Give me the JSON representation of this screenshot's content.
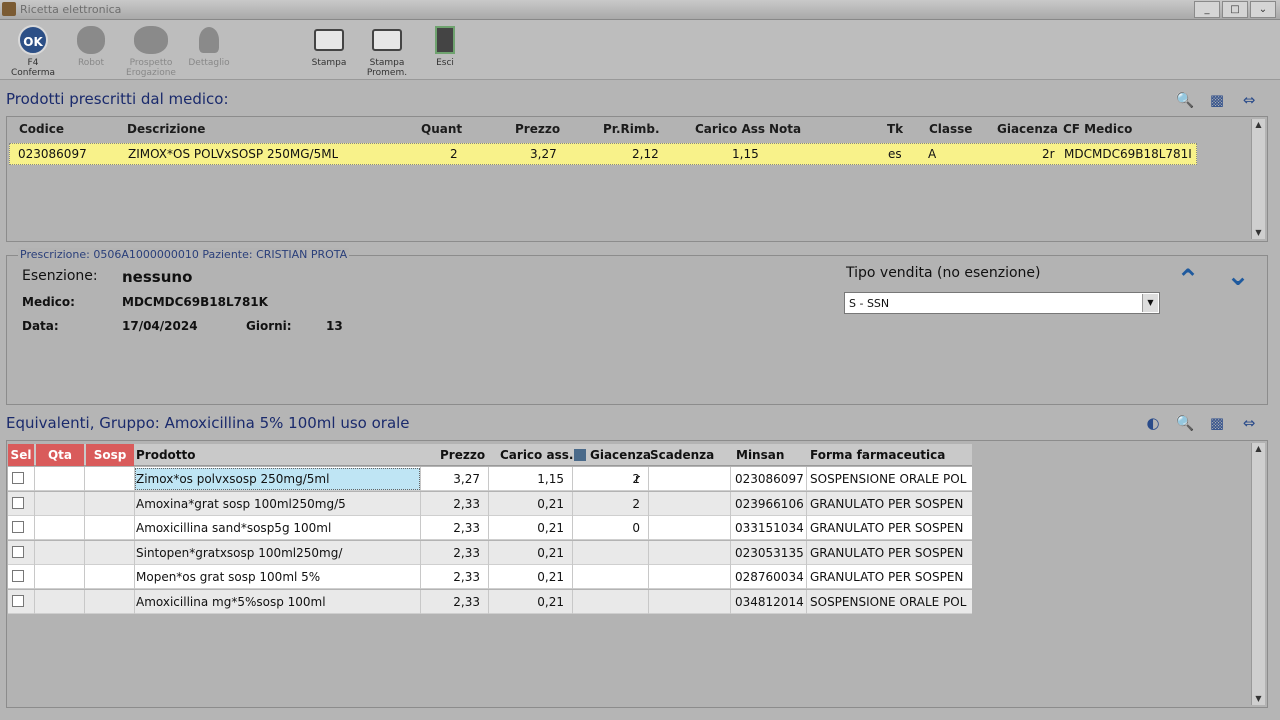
{
  "window": {
    "title": "Ricetta elettronica",
    "controls": [
      "_",
      "□",
      "⌄"
    ]
  },
  "toolbar": {
    "buttons": [
      {
        "label": "F4\nConferma",
        "icon": "ok-icon",
        "enabled": true
      },
      {
        "label": "Robot",
        "icon": "robot-icon",
        "enabled": false
      },
      {
        "label": "Prospetto\nErogazione",
        "icon": "prospetto-icon",
        "enabled": false
      },
      {
        "label": "Dettaglio",
        "icon": "dettaglio-icon",
        "enabled": false
      },
      {
        "label": "Stampa",
        "icon": "printer-icon",
        "enabled": true
      },
      {
        "label": "Stampa\nPromem.",
        "icon": "printer-memo-icon",
        "enabled": true
      },
      {
        "label": "Esci",
        "icon": "exit-icon",
        "enabled": true
      }
    ]
  },
  "prescribed": {
    "title": "Prodotti prescritti dal medico:",
    "columns": [
      "Codice",
      "Descrizione",
      "Quant",
      "Prezzo",
      "Pr.Rimb.",
      "Carico Ass",
      "Nota",
      "Tk",
      "Classe",
      "Giacenza",
      "CF Medico"
    ],
    "rows": [
      {
        "codice": "023086097",
        "descrizione": "ZIMOX*OS POLVxSOSP 250MG/5ML",
        "quant": "2",
        "prezzo": "3,27",
        "rimb": "2,12",
        "carico": "1,15",
        "nota": "",
        "tk": "es",
        "classe": "A",
        "giacenza": "2r",
        "cf": "MDCMDC69B18L781I"
      }
    ]
  },
  "prescription": {
    "legend": "Prescrizione: 0506A1000000010 Paziente: CRISTIAN PROTA",
    "esenzione_label": "Esenzione:",
    "esenzione_value": "nessuno",
    "medico_label": "Medico:",
    "medico_value": "MDCMDC69B18L781K",
    "data_label": "Data:",
    "data_value": "17/04/2024",
    "giorni_label": "Giorni:",
    "giorni_value": "13",
    "tipo_label": "Tipo vendita (no esenzione)",
    "tipo_value": "S - SSN"
  },
  "equivalents": {
    "title": "Equivalenti, Gruppo: Amoxicillina 5% 100ml uso orale",
    "columns": [
      "Sel",
      "Qta",
      "Sosp",
      "Prodotto",
      "Prezzo",
      "Carico ass.",
      "Giacenza",
      "Scadenza",
      "Minsan",
      "Forma farmaceutica"
    ],
    "rows": [
      {
        "prodotto": "Zimox*os polvxsosp 250mg/5ml",
        "prezzo": "3,27",
        "carico": "1,15",
        "giacenza": "2",
        "giac_flag": "r",
        "scadenza": "",
        "minsan": "023086097",
        "forma": "SOSPENSIONE ORALE POL"
      },
      {
        "prodotto": "Amoxina*grat sosp 100ml250mg/5",
        "prezzo": "2,33",
        "carico": "0,21",
        "giacenza": "2",
        "giac_flag": "",
        "scadenza": "",
        "minsan": "023966106",
        "forma": "GRANULATO PER SOSPEN"
      },
      {
        "prodotto": "Amoxicillina sand*sosp5g 100ml",
        "prezzo": "2,33",
        "carico": "0,21",
        "giacenza": "0",
        "giac_flag": "",
        "scadenza": "",
        "minsan": "033151034",
        "forma": "GRANULATO PER SOSPEN"
      },
      {
        "prodotto": "Sintopen*gratxsosp 100ml250mg/",
        "prezzo": "2,33",
        "carico": "0,21",
        "giacenza": "",
        "giac_flag": "",
        "scadenza": "",
        "minsan": "023053135",
        "forma": "GRANULATO PER SOSPEN"
      },
      {
        "prodotto": "Mopen*os grat sosp 100ml 5%",
        "prezzo": "2,33",
        "carico": "0,21",
        "giacenza": "",
        "giac_flag": "",
        "scadenza": "",
        "minsan": "028760034",
        "forma": "GRANULATO PER SOSPEN"
      },
      {
        "prodotto": "Amoxicillina mg*5%sosp 100ml",
        "prezzo": "2,33",
        "carico": "0,21",
        "giacenza": "",
        "giac_flag": "",
        "scadenza": "",
        "minsan": "034812014",
        "forma": "SOSPENSIONE ORALE POL"
      }
    ]
  }
}
